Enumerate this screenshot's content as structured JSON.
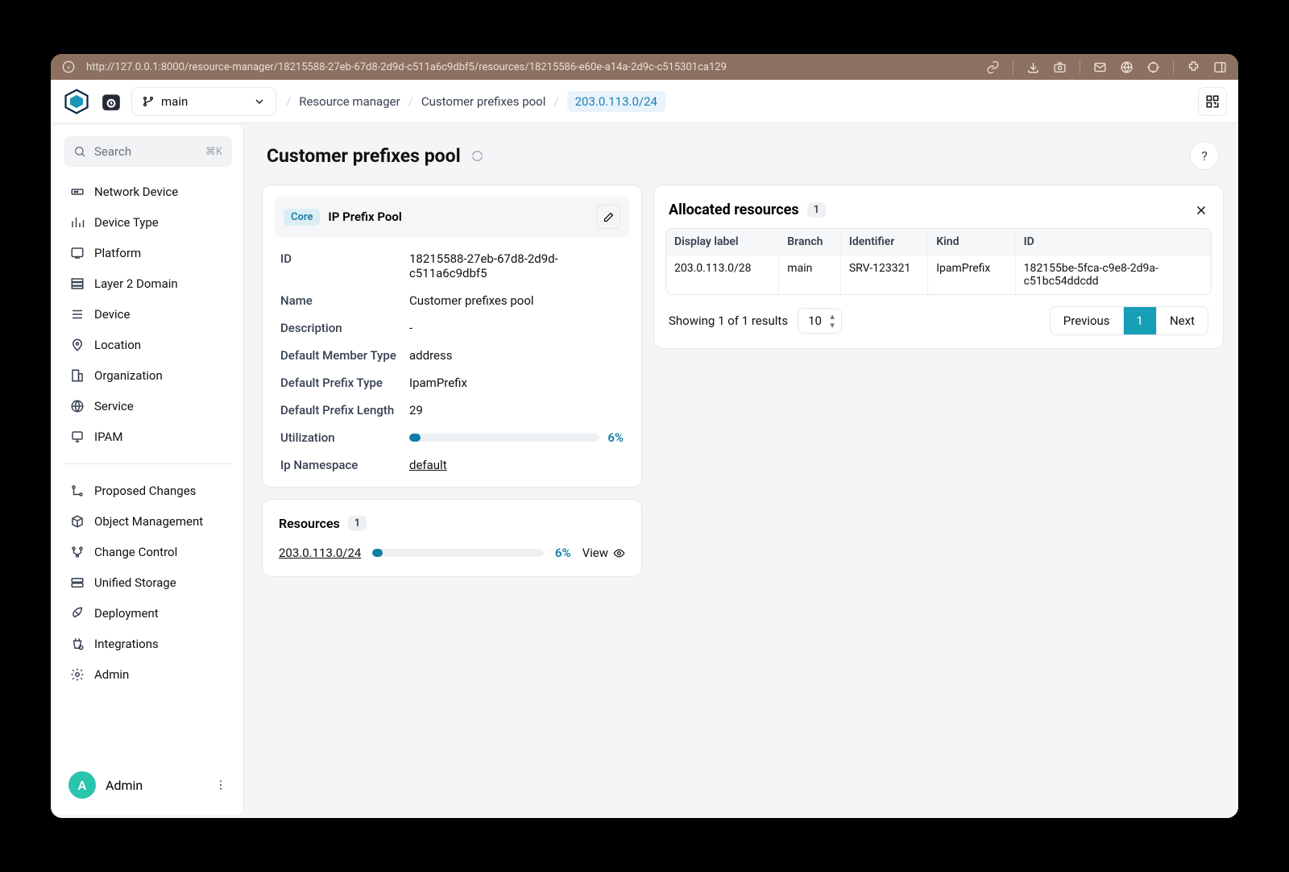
{
  "titlebar": {
    "url": "http://127.0.0.1:8000/resource-manager/18215588-27eb-67d8-2d9d-c511a6c9dbf5/resources/18215586-e60e-a14a-2d9c-c515301ca129"
  },
  "header": {
    "branch": "main",
    "crumbs": [
      "Resource manager",
      "Customer prefixes pool",
      "203.0.113.0/24"
    ]
  },
  "sidebar": {
    "search_placeholder": "Search",
    "search_kbd": "⌘K",
    "items": [
      {
        "label": "Network Device"
      },
      {
        "label": "Device Type"
      },
      {
        "label": "Platform"
      },
      {
        "label": "Layer 2 Domain"
      },
      {
        "label": "Device"
      },
      {
        "label": "Location"
      },
      {
        "label": "Organization"
      },
      {
        "label": "Service"
      },
      {
        "label": "IPAM"
      }
    ],
    "section2": [
      {
        "label": "Proposed Changes"
      },
      {
        "label": "Object Management"
      },
      {
        "label": "Change Control"
      },
      {
        "label": "Unified Storage"
      },
      {
        "label": "Deployment"
      },
      {
        "label": "Integrations"
      },
      {
        "label": "Admin"
      }
    ],
    "user": {
      "initial": "A",
      "name": "Admin"
    }
  },
  "page": {
    "title": "Customer prefixes pool"
  },
  "details": {
    "chip": "Core",
    "type_label": "IP Prefix Pool",
    "fields": {
      "id_label": "ID",
      "id": "18215588-27eb-67d8-2d9d-c511a6c9dbf5",
      "name_label": "Name",
      "name": "Customer prefixes pool",
      "desc_label": "Description",
      "desc": "-",
      "dmt_label": "Default Member Type",
      "dmt": "address",
      "dpt_label": "Default Prefix Type",
      "dpt": "IpamPrefix",
      "dpl_label": "Default Prefix Length",
      "dpl": "29",
      "util_label": "Utilization",
      "util_pct": "6%",
      "util_value": 6,
      "ns_label": "Ip Namespace",
      "ns": "default"
    }
  },
  "resources": {
    "title": "Resources",
    "count": "1",
    "row": {
      "name": "203.0.113.0/24",
      "pct": "6%",
      "pct_value": 6,
      "view": "View"
    }
  },
  "allocated": {
    "title": "Allocated resources",
    "count": "1",
    "columns": [
      "Display label",
      "Branch",
      "Identifier",
      "Kind",
      "ID"
    ],
    "rows": [
      {
        "display_label": "203.0.113.0/28",
        "branch": "main",
        "identifier": "SRV-123321",
        "kind": "IpamPrefix",
        "id": "182155be-5fca-c9e8-2d9a-c51bc54ddcdd"
      }
    ],
    "summary": "Showing 1 of 1 results",
    "page_size": "10",
    "prev": "Previous",
    "current": "1",
    "next": "Next"
  }
}
